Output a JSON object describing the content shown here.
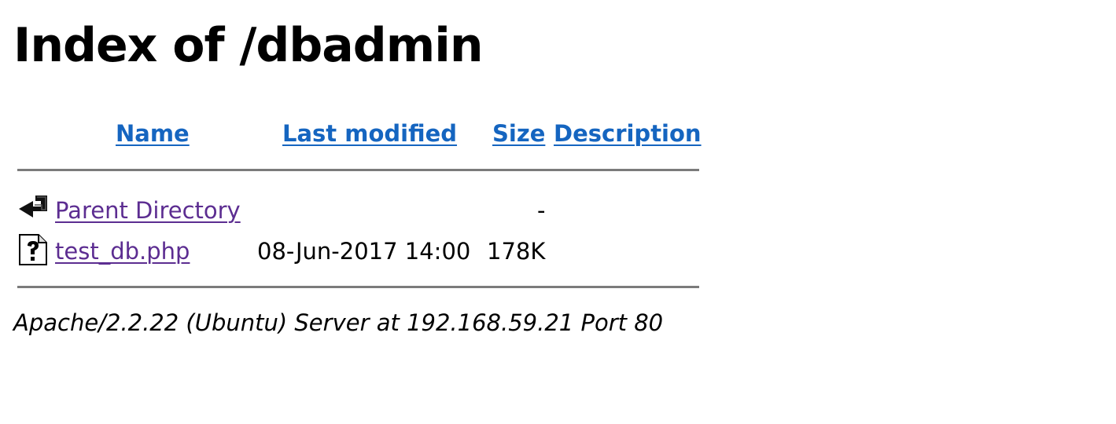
{
  "title": "Index of /dbadmin",
  "columns": {
    "name": "Name",
    "last_modified": "Last modified",
    "size": "Size",
    "description": "Description"
  },
  "entries": [
    {
      "icon": "back-arrow-icon",
      "name": "Parent Directory",
      "last_modified": "",
      "size": "-",
      "description": ""
    },
    {
      "icon": "unknown-file-icon",
      "name": "test_db.php",
      "last_modified": "08-Jun-2017 14:00",
      "size": "178K",
      "description": ""
    }
  ],
  "footer": "Apache/2.2.22 (Ubuntu) Server at 192.168.59.21 Port 80",
  "colors": {
    "header_link": "#1565c0",
    "visited_link": "#5c2d91",
    "rule": "#7b7b7b"
  }
}
